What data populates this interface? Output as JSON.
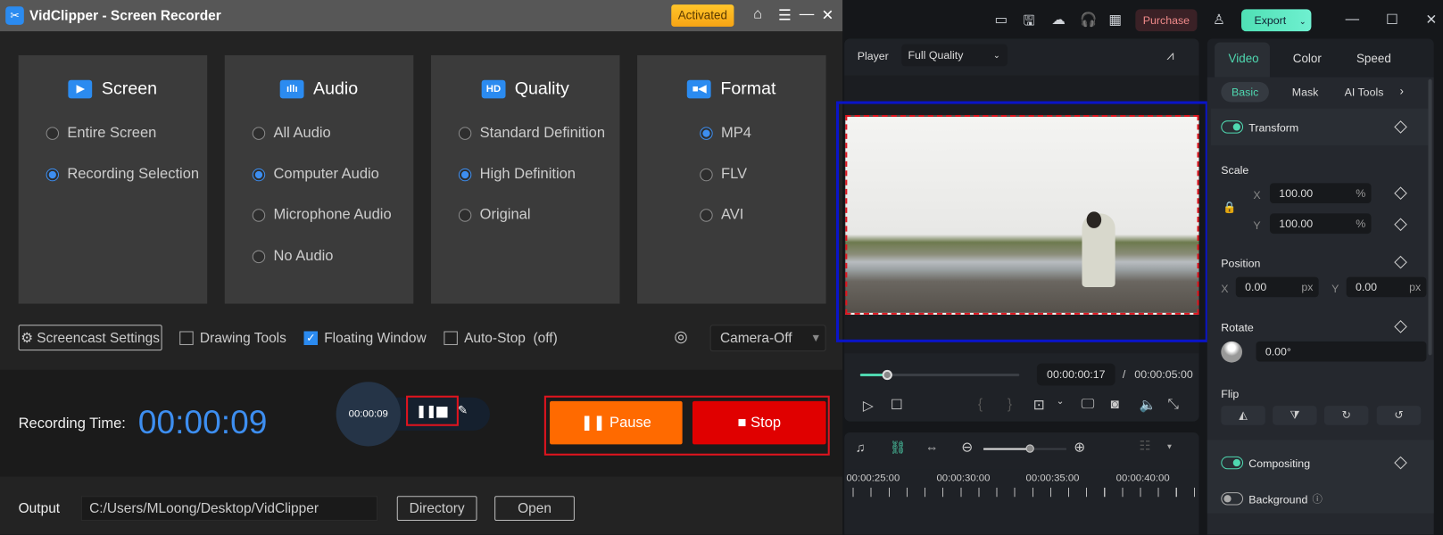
{
  "recorder": {
    "title": "VidClipper - Screen Recorder",
    "activated_label": "Activated",
    "cards": [
      {
        "title": "Screen",
        "icon": "play-screen-icon",
        "options": [
          {
            "label": "Entire Screen",
            "selected": false
          },
          {
            "label": "Recording Selection",
            "selected": true
          }
        ]
      },
      {
        "title": "Audio",
        "icon": "audio-wave-icon",
        "options": [
          {
            "label": "All Audio",
            "selected": false
          },
          {
            "label": "Computer Audio",
            "selected": true
          },
          {
            "label": "Microphone Audio",
            "selected": false
          },
          {
            "label": "No Audio",
            "selected": false
          }
        ]
      },
      {
        "title": "Quality",
        "icon": "hd-icon",
        "icon_text": "HD",
        "options": [
          {
            "label": "Standard Definition",
            "selected": false
          },
          {
            "label": "High Definition",
            "selected": true
          },
          {
            "label": "Original",
            "selected": false
          }
        ]
      },
      {
        "title": "Format",
        "icon": "camera-icon",
        "options": [
          {
            "label": "MP4",
            "selected": true
          },
          {
            "label": "FLV",
            "selected": false
          },
          {
            "label": "AVI",
            "selected": false
          }
        ]
      }
    ],
    "screencast_settings": "Screencast Settings",
    "drawing_tools": {
      "label": "Drawing Tools",
      "checked": false
    },
    "floating_window": {
      "label": "Floating Window",
      "checked": true
    },
    "auto_stop": {
      "label": "Auto-Stop  (off)",
      "checked": false
    },
    "camera_select": "Camera-Off",
    "recording_time_label": "Recording Time:",
    "recording_time": "00:00:09",
    "widget_time": "00:00:09",
    "pause_label": "Pause",
    "stop_label": "Stop",
    "output_label": "Output",
    "output_path": "C:/Users/MLoong/Desktop/VidClipper",
    "directory_label": "Directory",
    "open_label": "Open",
    "colors": {
      "accent": "#2b8bf0",
      "pause": "#ff6a00",
      "stop": "#e00000",
      "highlight": "#e0141e"
    }
  },
  "editor": {
    "purchase_label": "Purchase",
    "export_label": "Export",
    "player_label": "Player",
    "quality_select": "Full Quality",
    "current_time": "00:00:00:17",
    "total_time": "00:00:05:00",
    "progress": 0.17,
    "timeline_zoom": 0.55,
    "ruler": [
      "00:00:25:00",
      "00:00:30:00",
      "00:00:35:00",
      "00:00:40:00"
    ],
    "tabs": [
      "Video",
      "Color",
      "Speed"
    ],
    "active_tab": "Video",
    "subtabs": [
      "Basic",
      "Mask",
      "AI Tools"
    ],
    "transform_label": "Transform",
    "scale_label": "Scale",
    "scale_x": "100.00",
    "scale_y": "100.00",
    "percent": "%",
    "x_label": "X",
    "y_label": "Y",
    "px": "px",
    "position_label": "Position",
    "pos_x": "0.00",
    "pos_y": "0.00",
    "rotate_label": "Rotate",
    "rotate_value": "0.00°",
    "flip_label": "Flip",
    "compositing_label": "Compositing",
    "background_label": "Background",
    "colors": {
      "accent": "#4fd8b0",
      "selection_box": "#0a14c8"
    }
  }
}
